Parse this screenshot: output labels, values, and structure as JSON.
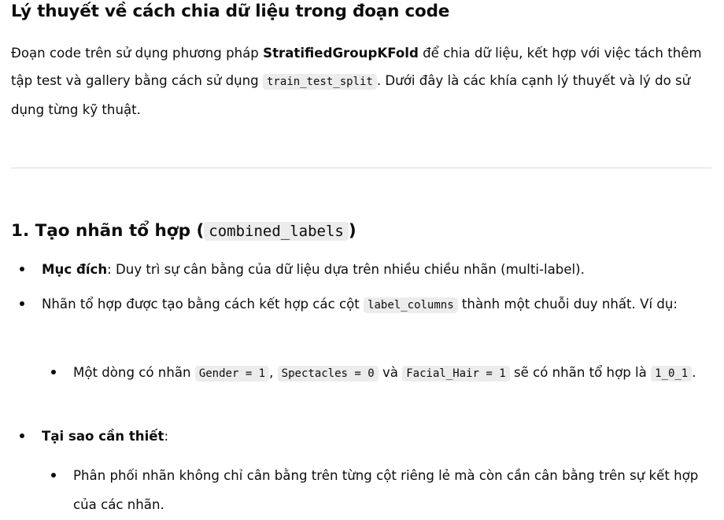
{
  "title": "Lý thuyết về cách chia dữ liệu trong đoạn code",
  "intro": {
    "text_before_bold": "Đoạn code trên sử dụng phương pháp ",
    "bold": "StratifiedGroupKFold",
    "text_after_bold": " để chia dữ liệu, kết hợp với việc tách thêm tập test và gallery bằng cách sử dụng ",
    "code": "train_test_split",
    "text_end": ". Dưới đây là các khía cạnh lý thuyết và lý do sử dụng từng kỹ thuật."
  },
  "section1": {
    "title_prefix": "1. Tạo nhãn tổ hợp (",
    "title_code": "combined_labels",
    "title_suffix": ")",
    "purpose_label": "Mục đích",
    "purpose_text": ": Duy trì sự cân bằng của dữ liệu dựa trên nhiều chiều nhãn (multi-label).",
    "combine_before": "Nhãn tổ hợp được tạo bằng cách kết hợp các cột ",
    "combine_code": "label_columns",
    "combine_after": " thành một chuỗi duy nhất. Ví dụ:",
    "example": {
      "t1": "Một dòng có nhãn ",
      "c1": "Gender = 1",
      "t2": ", ",
      "c2": "Spectacles = 0",
      "t3": " và ",
      "c3": "Facial_Hair = 1",
      "t4": " sẽ có nhãn tổ hợp là ",
      "c4": "1_0_1",
      "t5": "."
    },
    "why_label": "Tại sao cần thiết",
    "why_suffix": ":",
    "why_item": "Phân phối nhãn không chỉ cân bằng trên từng cột riêng lẻ mà còn cần cân bằng trên sự kết hợp của các nhãn."
  }
}
